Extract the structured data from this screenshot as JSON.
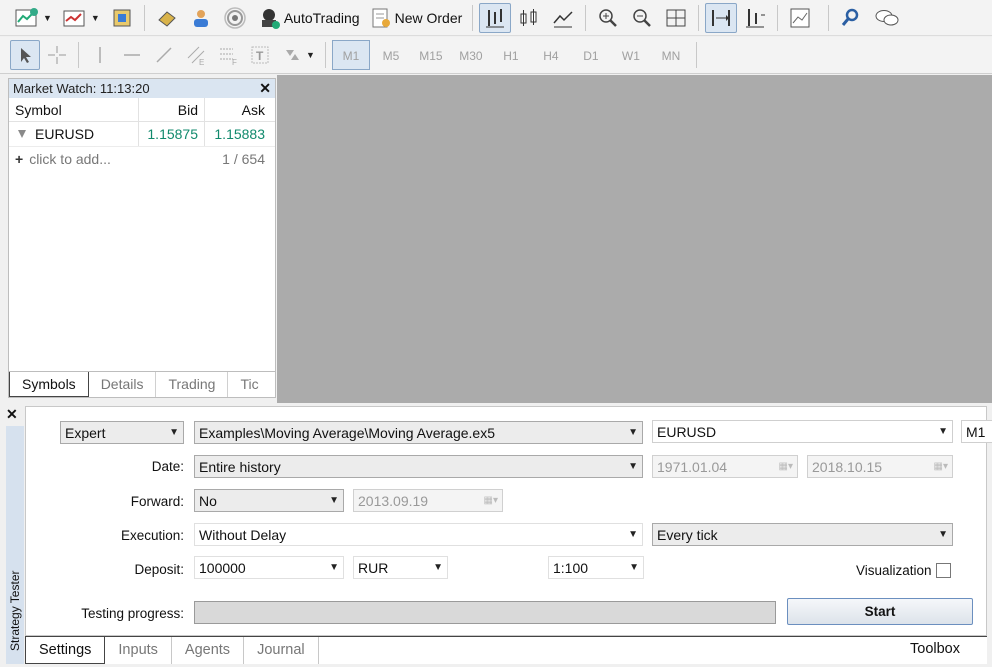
{
  "toolbar": {
    "autotrading_label": "AutoTrading",
    "new_order_label": "New Order"
  },
  "timeframes": [
    "M1",
    "M5",
    "M15",
    "M30",
    "H1",
    "H4",
    "D1",
    "W1",
    "MN"
  ],
  "market_watch": {
    "title": "Market Watch: 11:13:20",
    "columns": {
      "symbol": "Symbol",
      "bid": "Bid",
      "ask": "Ask"
    },
    "rows": [
      {
        "symbol": "EURUSD",
        "bid": "1.15875",
        "ask": "1.15883"
      }
    ],
    "add_text": "click to add...",
    "count": "1 / 654",
    "tabs": [
      "Symbols",
      "Details",
      "Trading",
      "Tic"
    ]
  },
  "tester": {
    "side_title": "Strategy Tester",
    "mode": "Expert",
    "expert": "Examples\\Moving Average\\Moving Average.ex5",
    "symbol": "EURUSD",
    "period": "M1",
    "date_label": "Date:",
    "date_value": "Entire history",
    "date_from": "1971.01.04",
    "date_to": "2018.10.15",
    "forward_label": "Forward:",
    "forward_value": "No",
    "forward_date": "2013.09.19",
    "execution_label": "Execution:",
    "execution_value": "Without Delay",
    "ticks_value": "Every tick",
    "deposit_label": "Deposit:",
    "deposit_value": "100000",
    "currency": "RUR",
    "leverage": "1:100",
    "visualization_label": "Visualization",
    "progress_label": "Testing progress:",
    "progress": 0,
    "start_label": "Start",
    "tabs": [
      "Settings",
      "Inputs",
      "Agents",
      "Journal"
    ],
    "toolbox_label": "Toolbox"
  }
}
